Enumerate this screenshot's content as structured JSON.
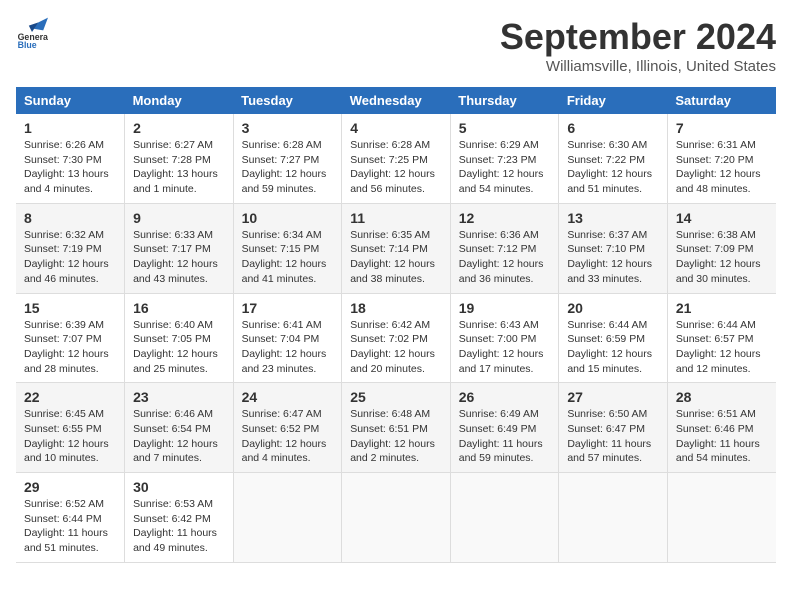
{
  "header": {
    "logo_line1": "General",
    "logo_line2": "Blue",
    "month": "September 2024",
    "location": "Williamsville, Illinois, United States"
  },
  "weekdays": [
    "Sunday",
    "Monday",
    "Tuesday",
    "Wednesday",
    "Thursday",
    "Friday",
    "Saturday"
  ],
  "weeks": [
    [
      {
        "day": "1",
        "info": "Sunrise: 6:26 AM\nSunset: 7:30 PM\nDaylight: 13 hours\nand 4 minutes."
      },
      {
        "day": "2",
        "info": "Sunrise: 6:27 AM\nSunset: 7:28 PM\nDaylight: 13 hours\nand 1 minute."
      },
      {
        "day": "3",
        "info": "Sunrise: 6:28 AM\nSunset: 7:27 PM\nDaylight: 12 hours\nand 59 minutes."
      },
      {
        "day": "4",
        "info": "Sunrise: 6:28 AM\nSunset: 7:25 PM\nDaylight: 12 hours\nand 56 minutes."
      },
      {
        "day": "5",
        "info": "Sunrise: 6:29 AM\nSunset: 7:23 PM\nDaylight: 12 hours\nand 54 minutes."
      },
      {
        "day": "6",
        "info": "Sunrise: 6:30 AM\nSunset: 7:22 PM\nDaylight: 12 hours\nand 51 minutes."
      },
      {
        "day": "7",
        "info": "Sunrise: 6:31 AM\nSunset: 7:20 PM\nDaylight: 12 hours\nand 48 minutes."
      }
    ],
    [
      {
        "day": "8",
        "info": "Sunrise: 6:32 AM\nSunset: 7:19 PM\nDaylight: 12 hours\nand 46 minutes."
      },
      {
        "day": "9",
        "info": "Sunrise: 6:33 AM\nSunset: 7:17 PM\nDaylight: 12 hours\nand 43 minutes."
      },
      {
        "day": "10",
        "info": "Sunrise: 6:34 AM\nSunset: 7:15 PM\nDaylight: 12 hours\nand 41 minutes."
      },
      {
        "day": "11",
        "info": "Sunrise: 6:35 AM\nSunset: 7:14 PM\nDaylight: 12 hours\nand 38 minutes."
      },
      {
        "day": "12",
        "info": "Sunrise: 6:36 AM\nSunset: 7:12 PM\nDaylight: 12 hours\nand 36 minutes."
      },
      {
        "day": "13",
        "info": "Sunrise: 6:37 AM\nSunset: 7:10 PM\nDaylight: 12 hours\nand 33 minutes."
      },
      {
        "day": "14",
        "info": "Sunrise: 6:38 AM\nSunset: 7:09 PM\nDaylight: 12 hours\nand 30 minutes."
      }
    ],
    [
      {
        "day": "15",
        "info": "Sunrise: 6:39 AM\nSunset: 7:07 PM\nDaylight: 12 hours\nand 28 minutes."
      },
      {
        "day": "16",
        "info": "Sunrise: 6:40 AM\nSunset: 7:05 PM\nDaylight: 12 hours\nand 25 minutes."
      },
      {
        "day": "17",
        "info": "Sunrise: 6:41 AM\nSunset: 7:04 PM\nDaylight: 12 hours\nand 23 minutes."
      },
      {
        "day": "18",
        "info": "Sunrise: 6:42 AM\nSunset: 7:02 PM\nDaylight: 12 hours\nand 20 minutes."
      },
      {
        "day": "19",
        "info": "Sunrise: 6:43 AM\nSunset: 7:00 PM\nDaylight: 12 hours\nand 17 minutes."
      },
      {
        "day": "20",
        "info": "Sunrise: 6:44 AM\nSunset: 6:59 PM\nDaylight: 12 hours\nand 15 minutes."
      },
      {
        "day": "21",
        "info": "Sunrise: 6:44 AM\nSunset: 6:57 PM\nDaylight: 12 hours\nand 12 minutes."
      }
    ],
    [
      {
        "day": "22",
        "info": "Sunrise: 6:45 AM\nSunset: 6:55 PM\nDaylight: 12 hours\nand 10 minutes."
      },
      {
        "day": "23",
        "info": "Sunrise: 6:46 AM\nSunset: 6:54 PM\nDaylight: 12 hours\nand 7 minutes."
      },
      {
        "day": "24",
        "info": "Sunrise: 6:47 AM\nSunset: 6:52 PM\nDaylight: 12 hours\nand 4 minutes."
      },
      {
        "day": "25",
        "info": "Sunrise: 6:48 AM\nSunset: 6:51 PM\nDaylight: 12 hours\nand 2 minutes."
      },
      {
        "day": "26",
        "info": "Sunrise: 6:49 AM\nSunset: 6:49 PM\nDaylight: 11 hours\nand 59 minutes."
      },
      {
        "day": "27",
        "info": "Sunrise: 6:50 AM\nSunset: 6:47 PM\nDaylight: 11 hours\nand 57 minutes."
      },
      {
        "day": "28",
        "info": "Sunrise: 6:51 AM\nSunset: 6:46 PM\nDaylight: 11 hours\nand 54 minutes."
      }
    ],
    [
      {
        "day": "29",
        "info": "Sunrise: 6:52 AM\nSunset: 6:44 PM\nDaylight: 11 hours\nand 51 minutes."
      },
      {
        "day": "30",
        "info": "Sunrise: 6:53 AM\nSunset: 6:42 PM\nDaylight: 11 hours\nand 49 minutes."
      },
      {
        "day": "",
        "info": ""
      },
      {
        "day": "",
        "info": ""
      },
      {
        "day": "",
        "info": ""
      },
      {
        "day": "",
        "info": ""
      },
      {
        "day": "",
        "info": ""
      }
    ]
  ]
}
